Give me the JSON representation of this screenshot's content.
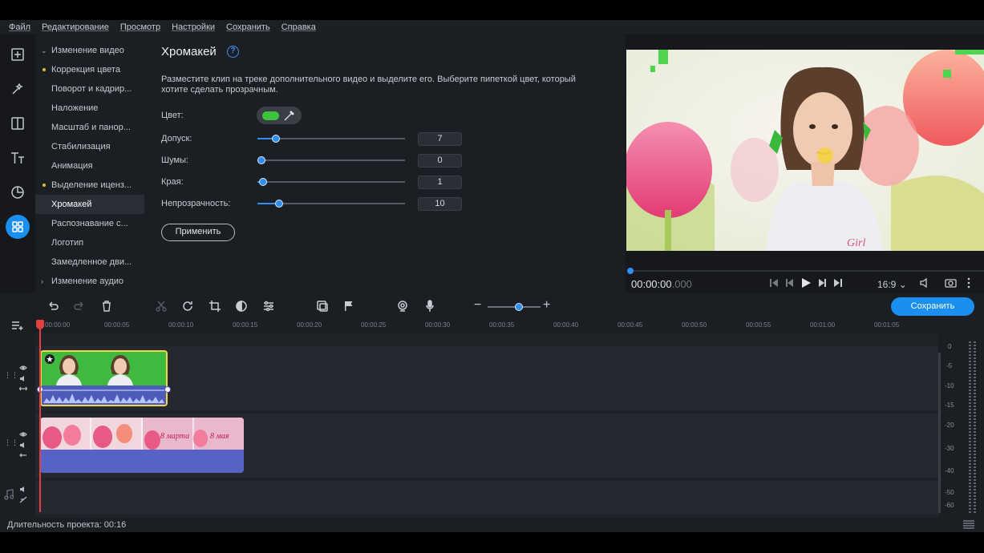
{
  "menu": [
    "Файл",
    "Редактирование",
    "Просмотр",
    "Настройки",
    "Сохранить",
    "Справка"
  ],
  "left_toolbar": [
    {
      "icon": "import-file-icon"
    },
    {
      "icon": "magic-wand-icon"
    },
    {
      "icon": "transitions-icon"
    },
    {
      "icon": "titles-icon"
    },
    {
      "icon": "stickers-icon"
    },
    {
      "icon": "more-tools-icon"
    }
  ],
  "nav": {
    "items": [
      {
        "label": "Изменение видео",
        "type": "group-open"
      },
      {
        "label": "Коррекция цвета",
        "type": "dot"
      },
      {
        "label": "Поворот и кадрир...",
        "type": "item"
      },
      {
        "label": "Наложение",
        "type": "item"
      },
      {
        "label": "Масштаб и панор...",
        "type": "item"
      },
      {
        "label": "Стабилизация",
        "type": "item"
      },
      {
        "label": "Анимация",
        "type": "item"
      },
      {
        "label": "Выделение иценз...",
        "type": "dot"
      },
      {
        "label": "Хромакей",
        "type": "selected"
      },
      {
        "label": "Распознавание с...",
        "type": "item"
      },
      {
        "label": "Логотип",
        "type": "item"
      },
      {
        "label": "Замедленное дви...",
        "type": "item"
      },
      {
        "label": "Изменение аудио",
        "type": "group-closed"
      }
    ]
  },
  "panel": {
    "title": "Хромакей",
    "help": "?",
    "description": "Разместите клип на треке дополнительного видео и выделите его. Выберите пипеткой цвет, который хотите сделать прозрачным.",
    "color_label": "Цвет:",
    "key_color": "#3fc33f",
    "sliders": [
      {
        "label": "Допуск:",
        "value": "7",
        "level": 0.1
      },
      {
        "label": "Шумы:",
        "value": "0",
        "level": 0.0
      },
      {
        "label": "Края:",
        "value": "1",
        "level": 0.01
      },
      {
        "label": "Непрозрачность:",
        "value": "10",
        "level": 0.12
      }
    ],
    "apply_label": "Применить"
  },
  "player": {
    "timecode_main": "00:00:00",
    "timecode_ms": ".000",
    "aspect": "16:9",
    "aspect_caret": "⌄",
    "progress": 0.0
  },
  "toolbar": {
    "save_label": "Сохранить",
    "zoom_minus": "−",
    "zoom_plus": "+"
  },
  "ruler": [
    "00:00:00",
    "00:00:05",
    "00:00:10",
    "00:00:15",
    "00:00:20",
    "00:00:25",
    "00:00:30",
    "00:00:35",
    "00:00:40",
    "00:00:45",
    "00:00:50",
    "00:00:55",
    "00:01:00",
    "00:01:05"
  ],
  "meter_labels": [
    "0",
    "-5",
    "-10",
    "-15",
    "-20",
    "-30",
    "-40",
    "-50",
    "-60"
  ],
  "clip_texts": {
    "girl_shirt": "Girl",
    "march8a": "8 марта",
    "march8b": "8 мая"
  },
  "status": {
    "duration": "Длительность проекта: 00:16"
  },
  "colors": {
    "accent": "#1a8ff0",
    "background": "#1b1e23",
    "playhead": "#e0413f",
    "clip_border": "#f1d54b"
  }
}
